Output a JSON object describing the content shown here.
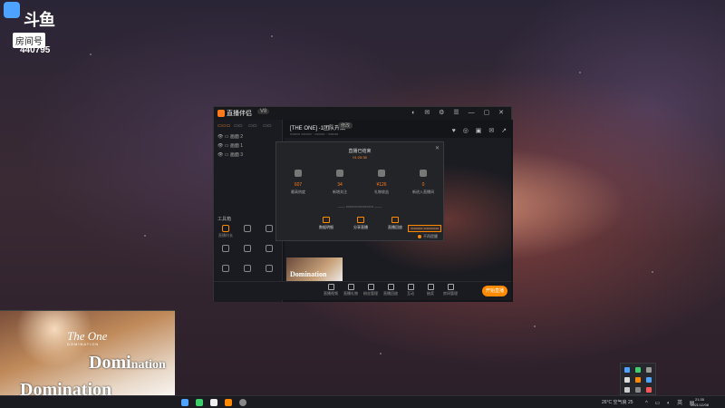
{
  "overlay": {
    "brand_name": "斗鱼",
    "room_label": "房间号",
    "room_id": "440795"
  },
  "app": {
    "name": "直播伴侣",
    "version": "V8"
  },
  "sidebar": {
    "scenes": [
      "画面 2",
      "画面 1",
      "画面 3"
    ],
    "tools_title": "工具箱",
    "tools": [
      "直播时长",
      "",
      "",
      "",
      "",
      "",
      "",
      "",
      "",
      "",
      "",
      "",
      "",
      "",
      ""
    ],
    "notice": "点击直播中右侧发布"
  },
  "stream": {
    "title": "[THE ONE] -1团队开始",
    "tag": "修改"
  },
  "popup": {
    "title": "直播已结束",
    "subtitle": "01:25:38",
    "stats": [
      {
        "value": "607",
        "label": "最高热度"
      },
      {
        "value": "34",
        "label": "新增关注"
      },
      {
        "value": "¥126",
        "label": "礼物收益"
      },
      {
        "value": "0",
        "label": "新进入直播间"
      }
    ],
    "actions": [
      "数据明细",
      "分享直播",
      "直播回放"
    ],
    "checkbox_label": "不再提醒"
  },
  "bottombar": {
    "items": [
      "直播视频",
      "直播礼物",
      "粉丝管理",
      "直播回放",
      "互动",
      "抽奖",
      "房间管理"
    ],
    "start_button": "开始直播"
  },
  "game": {
    "logo_line1": "The One",
    "logo_line2": "DOMINATION",
    "main_title": "Domination"
  },
  "taskbar": {
    "weather": "26°C 空气良 25",
    "time": "21:35",
    "date": "2021/12/08"
  },
  "colors": {
    "accent": "#ff8a00",
    "window_bg": "#1c1d22"
  }
}
